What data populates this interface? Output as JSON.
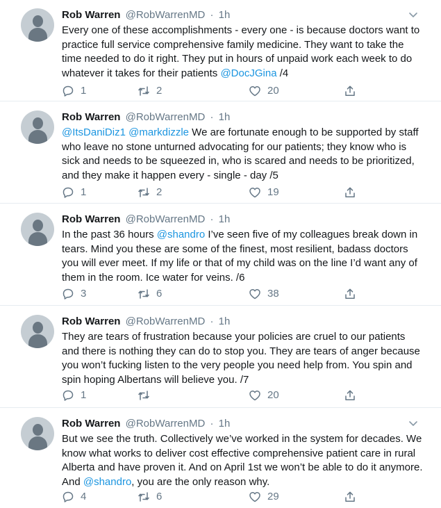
{
  "tweets": [
    {
      "name": "Rob Warren",
      "handle": "@RobWarrenMD",
      "dot": "·",
      "time": "1h",
      "text_segments": [
        {
          "t": "Every one of these accomplishments - every one - is because doctors want to practice full service comprehensive family medicine. They want to take the time needed to do it right. They put in hours of unpaid work each week to do whatever it takes for their patients "
        },
        {
          "t": "@DocJGina",
          "mention": true
        },
        {
          "t": " /4"
        }
      ],
      "replies": "1",
      "retweets": "2",
      "likes": "20"
    },
    {
      "name": "Rob Warren",
      "handle": "@RobWarrenMD",
      "dot": "·",
      "time": "1h",
      "text_segments": [
        {
          "t": "@ItsDaniDiz1",
          "mention": true
        },
        {
          "t": " "
        },
        {
          "t": "@markdizzle",
          "mention": true
        },
        {
          "t": " We are fortunate enough to be supported by staff who leave no stone unturned advocating for our patients; they know who is sick and needs to be squeezed in, who is scared and needs to be prioritized, and they make it happen every - single - day /5"
        }
      ],
      "replies": "1",
      "retweets": "2",
      "likes": "19"
    },
    {
      "name": "Rob Warren",
      "handle": "@RobWarrenMD",
      "dot": "·",
      "time": "1h",
      "text_segments": [
        {
          "t": "In the past 36 hours "
        },
        {
          "t": "@shandro",
          "mention": true
        },
        {
          "t": " I’ve seen five of my colleagues break down in tears. Mind you these are some of the finest, most resilient, badass doctors you will ever meet. If my life or that of my child was on the line I’d want any of them in the room. Ice water for veins. /6"
        }
      ],
      "replies": "3",
      "retweets": "6",
      "likes": "38"
    },
    {
      "name": "Rob Warren",
      "handle": "@RobWarrenMD",
      "dot": "·",
      "time": "1h",
      "text_segments": [
        {
          "t": "They are tears of frustration because your policies are cruel to our patients and there is nothing they can do to stop you. They are tears of anger because you won’t fucking listen to the very people you need help from. You spin and spin hoping Albertans will believe you. /7"
        }
      ],
      "replies": "1",
      "retweets": "",
      "likes": "20"
    },
    {
      "name": "Rob Warren",
      "handle": "@RobWarrenMD",
      "dot": "·",
      "time": "1h",
      "text_segments": [
        {
          "t": "But we see the truth. Collectively we’ve worked in the system for decades. We know what works to deliver cost effective comprehensive patient care in rural Alberta and have proven it. And on April 1st we won’t be able to do it anymore.  And "
        },
        {
          "t": "@shandro",
          "mention": true
        },
        {
          "t": ", you are the only reason why."
        }
      ],
      "replies": "4",
      "retweets": "6",
      "likes": "29"
    }
  ],
  "icons": {
    "reply": "reply-icon",
    "retweet": "retweet-icon",
    "like": "heart-icon",
    "share": "share-icon",
    "more": "chevron-down-icon",
    "avatar": "default-avatar"
  },
  "colors": {
    "mention": "#1b95e0",
    "secondary_text": "#657786",
    "divider": "#e6ecf0"
  }
}
